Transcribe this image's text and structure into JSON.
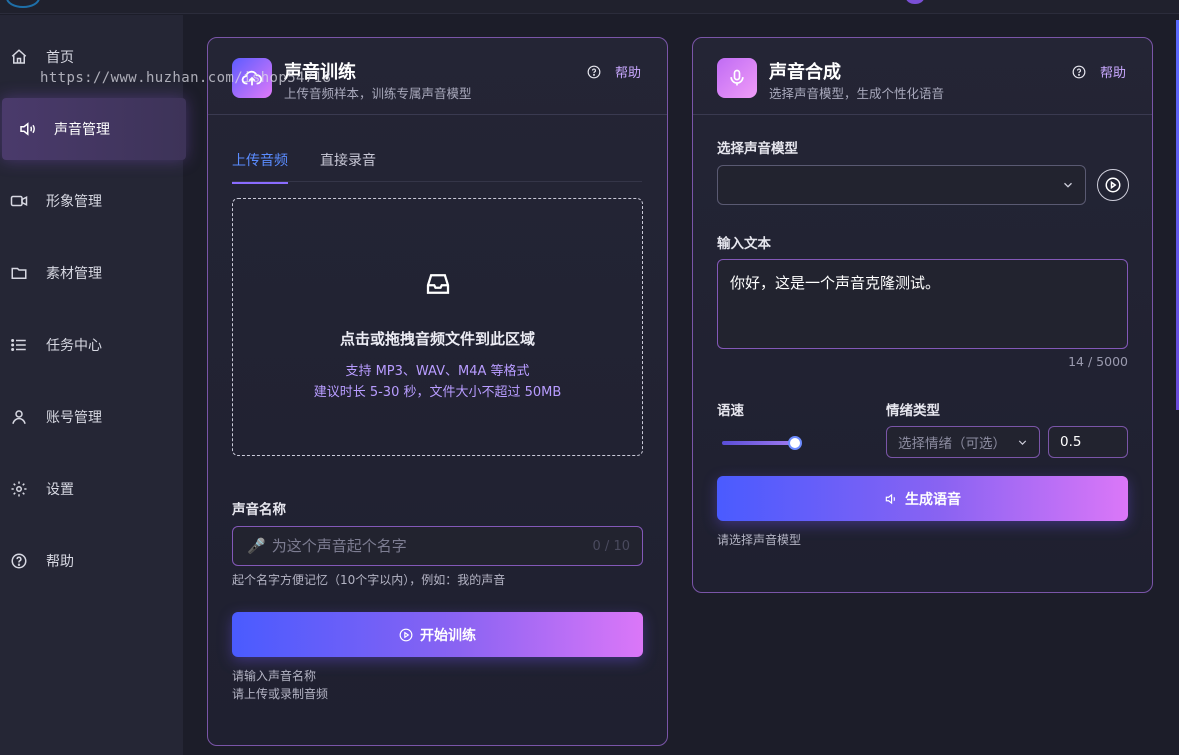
{
  "watermark": "https://www.huzhan.com/ishop54718",
  "sidebar": {
    "items": [
      {
        "label": "首页",
        "icon": "home-icon"
      },
      {
        "label": "声音管理",
        "icon": "speaker-icon",
        "active": true
      },
      {
        "label": "形象管理",
        "icon": "video-icon"
      },
      {
        "label": "素材管理",
        "icon": "folder-icon"
      },
      {
        "label": "任务中心",
        "icon": "list-icon"
      },
      {
        "label": "账号管理",
        "icon": "user-icon"
      },
      {
        "label": "设置",
        "icon": "gear-icon"
      },
      {
        "label": "帮助",
        "icon": "help-circle-icon"
      }
    ]
  },
  "training": {
    "title": "声音训练",
    "subtitle": "上传音频样本，训练专属声音模型",
    "help_label": "帮助",
    "tabs": [
      "上传音频",
      "直接录音"
    ],
    "active_tab": "上传音频",
    "dropzone": {
      "title": "点击或拖拽音频文件到此区域",
      "formats": "支持 MP3、WAV、M4A 等格式",
      "limits": "建议时长 5-30 秒，文件大小不超过 50MB"
    },
    "name_label": "声音名称",
    "name_placeholder": "为这个声音起个名字",
    "name_value": "",
    "name_count": "0 / 10",
    "name_hint": "起个名字方便记忆（10个字以内），例如：我的声音",
    "start_button": "开始训练",
    "validation": [
      "请输入声音名称",
      "请上传或录制音频"
    ]
  },
  "synthesis": {
    "title": "声音合成",
    "subtitle": "选择声音模型，生成个性化语音",
    "help_label": "帮助",
    "model_label": "选择声音模型",
    "model_value": "",
    "text_label": "输入文本",
    "text_value": "你好，这是一个声音克隆测试。",
    "text_count": "14 / 5000",
    "speed_label": "语速",
    "speed_level": 1.0,
    "emotion_label": "情绪类型",
    "emotion_placeholder": "选择情绪（可选）",
    "intensity_value": "0.5",
    "generate_button": "生成语音",
    "validation": "请选择声音模型"
  },
  "colors": {
    "accent": "#8a63f2",
    "gradient_start": "#4a5bff",
    "gradient_end": "#db77f8",
    "card_border": "#7a55a8",
    "tab_active": "#5a8cff"
  }
}
